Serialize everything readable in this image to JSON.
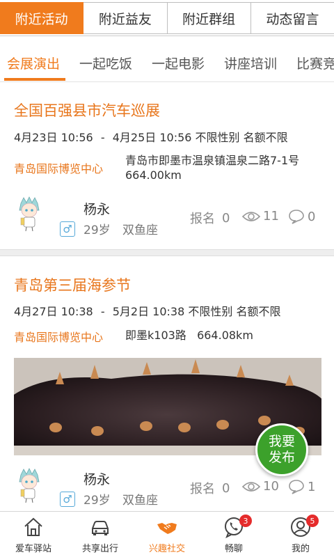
{
  "top_tabs": [
    {
      "label": "附近活动",
      "active": true
    },
    {
      "label": "附近益友",
      "active": false
    },
    {
      "label": "附近群组",
      "active": false
    },
    {
      "label": "动态留言",
      "active": false
    }
  ],
  "categories": [
    {
      "label": "会展演出",
      "active": true
    },
    {
      "label": "一起吃饭",
      "active": false
    },
    {
      "label": "一起电影",
      "active": false
    },
    {
      "label": "讲座培训",
      "active": false
    },
    {
      "label": "比赛竞",
      "active": false
    }
  ],
  "events": [
    {
      "title": "全国百强县市汽车巡展",
      "start": "4月23日 10:56",
      "separator": "-",
      "end_and_rules": "4月25日 10:56 不限性别 名额不限",
      "venue": "青岛国际博览中心",
      "address_line1": "青岛市即墨市温泉镇温泉二路7-1号",
      "address_line2": "664.00km",
      "user": {
        "name": "杨永",
        "gender_symbol": "♂",
        "age": "29岁",
        "zodiac": "双鱼座"
      },
      "signups_label": "报名",
      "signups": "0",
      "views": "11",
      "comments": "0"
    },
    {
      "title": "青岛第三届海参节",
      "start": "4月27日 10:38",
      "separator": "-",
      "end_and_rules": "5月2日 10:38 不限性别 名额不限",
      "venue": "青岛国际博览中心",
      "address_line1": "即墨k103路   664.08km",
      "user": {
        "name": "杨永",
        "gender_symbol": "♂",
        "age": "29岁",
        "zodiac": "双鱼座"
      },
      "signups_label": "报名",
      "signups": "0",
      "views": "10",
      "comments": "1"
    }
  ],
  "fab": {
    "line1": "我要",
    "line2": "发布"
  },
  "bottom_nav": [
    {
      "label": "爱车驿站",
      "icon": "home-icon",
      "badge": ""
    },
    {
      "label": "共享出行",
      "icon": "car-icon",
      "badge": ""
    },
    {
      "label": "兴趣社交",
      "icon": "handshake-icon",
      "badge": "",
      "active": true
    },
    {
      "label": "畅聊",
      "icon": "phone-chat-icon",
      "badge": "3"
    },
    {
      "label": "我的",
      "icon": "user-icon",
      "badge": "5"
    }
  ],
  "colors": {
    "accent": "#f07b1d",
    "fab": "#3ca12b",
    "badge": "#e52b2b",
    "gender": "#55a8d8"
  }
}
